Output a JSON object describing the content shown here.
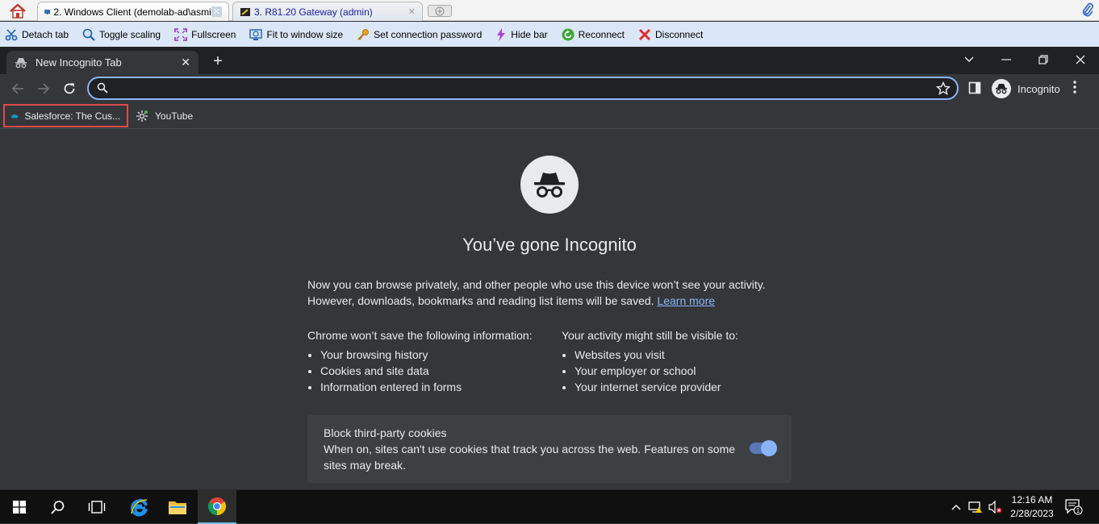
{
  "remote_tabs": [
    {
      "label": "2. Windows Client (demolab-ad\\asmi",
      "close": "✕"
    },
    {
      "label": "3. R81.20 Gateway (admin)",
      "close": "✕"
    }
  ],
  "remote_toolbar": {
    "detach": "Detach tab",
    "toggle_scaling": "Toggle scaling",
    "fullscreen": "Fullscreen",
    "fit": "Fit to window size",
    "set_password": "Set connection password",
    "hide_bar": "Hide bar",
    "reconnect": "Reconnect",
    "disconnect": "Disconnect"
  },
  "browser": {
    "tab_title": "New Incognito Tab",
    "tab_close": "✕",
    "new_tab": "+",
    "omnibox_value": "",
    "profile_label": "Incognito"
  },
  "bookmarks": [
    {
      "label": "Salesforce: The Cus..."
    },
    {
      "label": "YouTube"
    }
  ],
  "ntp": {
    "title": "You’ve gone Incognito",
    "intro": "Now you can browse privately, and other people who use this device won’t see your activity. However, downloads, bookmarks and reading list items will be saved.",
    "learn_more": "Learn more",
    "not_saved_heading": "Chrome won’t save the following information:",
    "not_saved_items": [
      "Your browsing history",
      "Cookies and site data",
      "Information entered in forms"
    ],
    "visible_heading": "Your activity might still be visible to:",
    "visible_items": [
      "Websites you visit",
      "Your employer or school",
      "Your internet service provider"
    ],
    "cookies_title": "Block third-party cookies",
    "cookies_desc": "When on, sites can't use cookies that track you across the web. Features on some sites may break.",
    "cookies_enabled": true
  },
  "taskbar": {
    "time": "12:16 AM",
    "date": "2/28/2023",
    "notification_count": "1"
  },
  "colors": {
    "chrome_bg": "#35363a",
    "accent": "#8ab4f8",
    "highlight_border": "#e04a4a"
  }
}
